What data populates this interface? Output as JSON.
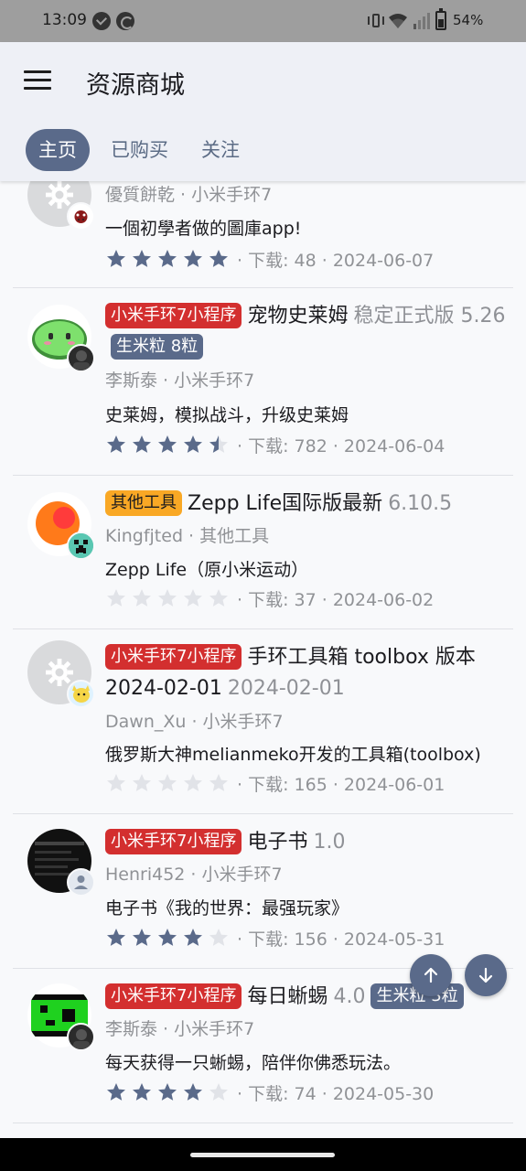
{
  "status_bar": {
    "time": "13:09",
    "battery": "54%"
  },
  "app_bar": {
    "title": "资源商城"
  },
  "tabs": [
    {
      "label": "主页",
      "active": true
    },
    {
      "label": "已购买",
      "active": false
    },
    {
      "label": "关注",
      "active": false
    }
  ],
  "colors": {
    "accent": "#5a6a8a",
    "tag_red": "#d32f2f",
    "tag_orange": "#f9a825",
    "star_filled": "#5a6a8a",
    "star_empty": "#e1e3e8"
  },
  "items": [
    {
      "author_line": "優質餅乾 · 小米手环7",
      "description": "一個初學者做的圖庫app!",
      "rating": 5,
      "stats": "· 下载: 48 · 2024-06-07",
      "icon": "gear-icon"
    },
    {
      "tag": "小米手环7小程序",
      "name": "宠物史莱姆",
      "version": "稳定正式版 5.26",
      "price": "生米粒 8粒",
      "author_line": "李斯泰 · 小米手环7",
      "description": "史莱姆，模拟战斗，升级史莱姆",
      "rating": 4.5,
      "stats": "· 下载: 782 · 2024-06-04",
      "icon": "slime-icon"
    },
    {
      "tag": "其他工具",
      "name": "Zepp Life国际版最新",
      "version": "6.10.5",
      "author_line": "Kingfjted · 其他工具",
      "description": "Zepp Life（原小米运动）",
      "rating": 0,
      "stats": "· 下载: 37 · 2024-06-02",
      "icon": "zepp-life-icon"
    },
    {
      "tag": "小米手环7小程序",
      "name": "手环工具箱 toolbox 版本 2024-02-01",
      "version": "2024-02-01",
      "author_line": "Dawn_Xu · 小米手环7",
      "description": "俄罗斯大神melianmeko开发的工具箱(toolbox)",
      "rating": 0,
      "stats": "· 下载: 165 · 2024-06-01",
      "icon": "gear-icon"
    },
    {
      "tag": "小米手环7小程序",
      "name": "电子书",
      "version": "1.0",
      "author_line": "Henri452 · 小米手环7",
      "description": "电子书《我的世界：最强玩家》",
      "rating": 4,
      "stats": "· 下载: 156 · 2024-05-31",
      "icon": "ebook-icon"
    },
    {
      "tag": "小米手环7小程序",
      "name": "每日蜥蜴",
      "version": "4.0",
      "price": "生米粒 3粒",
      "author_line": "李斯泰 · 小米手环7",
      "description": "每天获得一只蜥蜴，陪伴你佛悉玩法。",
      "rating": 4,
      "stats": "· 下载: 74 · 2024-05-30",
      "icon": "lizard-icon"
    }
  ]
}
